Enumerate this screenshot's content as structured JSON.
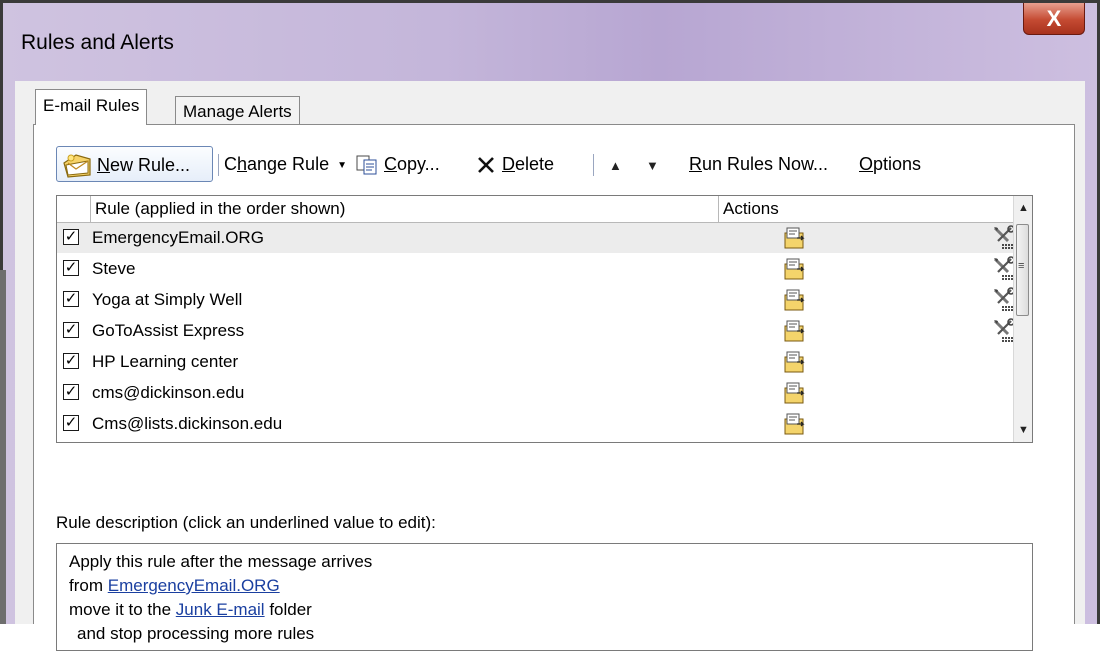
{
  "window": {
    "title": "Rules and Alerts",
    "close_label": "X"
  },
  "tabs": [
    {
      "label": "E-mail Rules",
      "active": true
    },
    {
      "label": "Manage Alerts",
      "active": false
    }
  ],
  "toolbar": {
    "new_rule_pre": "",
    "new_rule_u": "N",
    "new_rule_post": "ew Rule...",
    "change_rule_pre": "C",
    "change_rule_u": "h",
    "change_rule_post": "ange Rule",
    "copy_u": "C",
    "copy_post": "opy...",
    "delete_u": "D",
    "delete_post": "elete",
    "run_rules_u": "R",
    "run_rules_post": "un Rules Now...",
    "options_u": "O",
    "options_post": "ptions"
  },
  "grid": {
    "col_rule": "Rule (applied in the order shown)",
    "col_actions": "Actions",
    "rows": [
      {
        "name": "EmergencyEmail.ORG",
        "checked": true,
        "selected": true,
        "has_tool": true
      },
      {
        "name": "Steve",
        "checked": true,
        "selected": false,
        "has_tool": true
      },
      {
        "name": "Yoga at Simply Well",
        "checked": true,
        "selected": false,
        "has_tool": true
      },
      {
        "name": "GoToAssist Express",
        "checked": true,
        "selected": false,
        "has_tool": true
      },
      {
        "name": "HP Learning center",
        "checked": true,
        "selected": false,
        "has_tool": false
      },
      {
        "name": "cms@dickinson.edu",
        "checked": true,
        "selected": false,
        "has_tool": false
      },
      {
        "name": "Cms@lists.dickinson.edu",
        "checked": true,
        "selected": false,
        "has_tool": false
      }
    ]
  },
  "description": {
    "label": "Rule description (click an underlined value to edit):",
    "line1": "Apply this rule after the message arrives",
    "line2_pre": "from ",
    "line2_link": "EmergencyEmail.ORG",
    "line3_pre": "move it to the ",
    "line3_link": "Junk E-mail",
    "line3_post": " folder",
    "line4": "and stop processing more rules"
  },
  "icons": {
    "new_rule": "new-rule-icon",
    "copy": "copy-icon",
    "delete": "delete-icon",
    "move_up": "triangle-up-icon",
    "move_down": "triangle-down-icon",
    "action": "move-to-folder-icon",
    "tool": "tools-icon",
    "checkbox": "checkbox-checked-icon"
  }
}
